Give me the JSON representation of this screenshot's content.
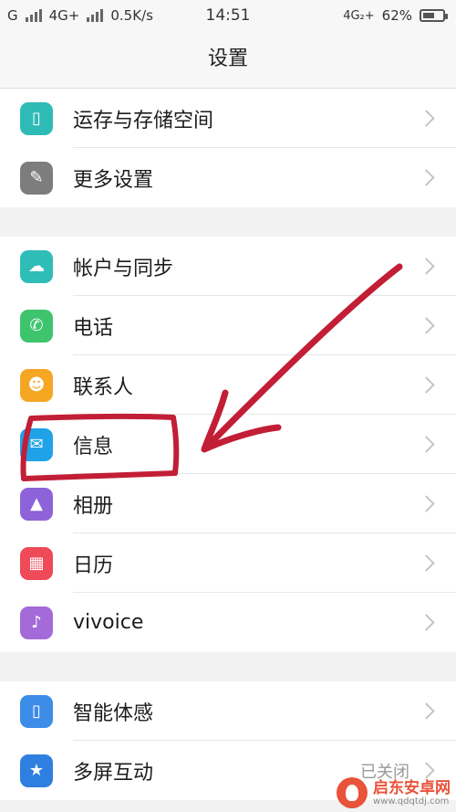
{
  "status": {
    "carrier1": "G",
    "carrier2": "4G+",
    "speed": "0.5K/s",
    "time": "14:51",
    "network_right": "4G₂+",
    "battery": "62%",
    "battery_level": 0.62
  },
  "header": {
    "title": "设置"
  },
  "groups": [
    {
      "items": [
        {
          "label": "运存与存储空间",
          "icon": "storage-icon",
          "color": "#2ebbb5",
          "glyph": "▯"
        },
        {
          "label": "更多设置",
          "icon": "wrench-icon",
          "color": "#7d7d7d",
          "glyph": "✎"
        }
      ]
    },
    {
      "items": [
        {
          "label": "帐户与同步",
          "icon": "cloud-icon",
          "color": "#2fbdb8",
          "glyph": "☁"
        },
        {
          "label": "电话",
          "icon": "phone-icon",
          "color": "#3dc46d",
          "glyph": "✆"
        },
        {
          "label": "联系人",
          "icon": "contact-icon",
          "color": "#f5a623",
          "glyph": "☻"
        },
        {
          "label": "信息",
          "icon": "message-icon",
          "color": "#1fa2e8",
          "glyph": "✉"
        },
        {
          "label": "相册",
          "icon": "gallery-icon",
          "color": "#8e62d8",
          "glyph": "▲"
        },
        {
          "label": "日历",
          "icon": "calendar-icon",
          "color": "#ee4a58",
          "glyph": "▦"
        },
        {
          "label": "vivoice",
          "icon": "microphone-icon",
          "color": "#a46ad8",
          "glyph": "♪"
        }
      ]
    },
    {
      "items": [
        {
          "label": "智能体感",
          "icon": "motion-icon",
          "color": "#3d8ce8",
          "glyph": "▯"
        },
        {
          "label": "多屏互动",
          "icon": "screen-cast-icon",
          "color": "#2f7fe0",
          "glyph": "★",
          "extra": "已关闭"
        }
      ]
    }
  ],
  "watermark": {
    "title": "启东安卓网",
    "url": "www.qdqtdj.com"
  },
  "colors": {
    "annotation": "#c21e35"
  }
}
